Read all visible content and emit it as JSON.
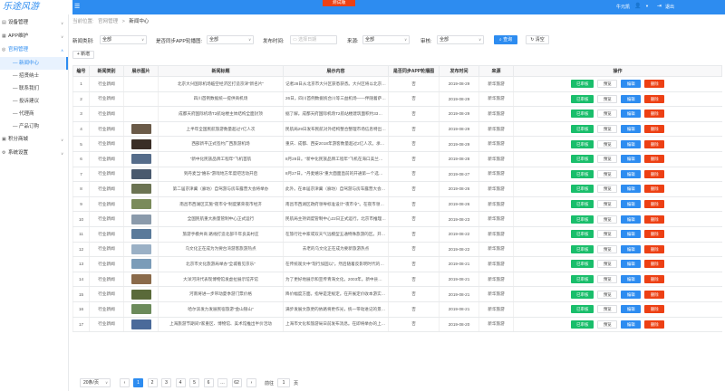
{
  "header": {
    "logo": "乐途风游",
    "env_tag": "测试版",
    "user": "牛元凯",
    "logout": "退出"
  },
  "sidebar": {
    "items": [
      {
        "label": "设备管理"
      },
      {
        "label": "APP维护"
      },
      {
        "label": "官网管理"
      }
    ],
    "subitems": [
      {
        "label": "— 新闻中心"
      },
      {
        "label": "— 招贤纳士"
      },
      {
        "label": "— 联系我们"
      },
      {
        "label": "— 投诉建议"
      },
      {
        "label": "— 代理商"
      },
      {
        "label": "— 产品订购"
      }
    ],
    "items_bottom": [
      {
        "label": "积分商城"
      },
      {
        "label": "系统设置"
      }
    ]
  },
  "breadcrumb": {
    "home_prefix": "当前位置:",
    "level1": "官网管理",
    "sep": ">",
    "level2": "新闻中心"
  },
  "filters": {
    "category_label": "新闻类别:",
    "category_value": "全部",
    "sync_label": "是否同步APP轮播图:",
    "sync_value": "全部",
    "time_label": "发布时间:",
    "time_placeholder": "选择日期",
    "source_label": "来源:",
    "source_value": "全部",
    "audit_label": "审核:",
    "audit_value": "全部",
    "query": "查询",
    "clear": "清空"
  },
  "toolbar": {
    "add": "+ 新增"
  },
  "table": {
    "headers": [
      "编号",
      "新闻类别",
      "展示图片",
      "新闻标题",
      "展示内容",
      "是否同步APP轮播图",
      "发布时间",
      "来源",
      "操作"
    ],
    "action_labels": {
      "audit": "已审核",
      "preview": "预览",
      "edit": "编辑",
      "delete": "删除"
    },
    "rows": [
      {
        "id": "1",
        "cat": "行业新闻",
        "title": "北京大兴国际机场临空经济区打造京津\"新名片\"",
        "content": "记者28日从北京市大兴区获悉获悉。大兴区将以北京大兴国际...",
        "sync": "否",
        "date": "2019-08-29",
        "src": "新华旅游",
        "thumb": ""
      },
      {
        "id": "2",
        "cat": "行业新闻",
        "title": "四川首例数据统一提供商机场",
        "content": "26日。四川首例数据统合川等三益机场——伴随着萨尔机场新...",
        "sync": "否",
        "date": "2019-08-29",
        "src": "新华旅游",
        "thumb": ""
      },
      {
        "id": "3",
        "cat": "行业新闻",
        "title": "成都天府国际机场T2航站楼主体结构全面封顶",
        "content": "据了解。成都天府国际机场T2航站楼建筑面积约33万平方米。...",
        "sync": "否",
        "date": "2019-08-29",
        "src": "新华旅游",
        "thumb": ""
      },
      {
        "id": "4",
        "cat": "行业新闻",
        "title": "上半年全国民航旅游数量超过7亿人次",
        "content": "民航局29日发布民航对外结构整合整理市场信息特出，今年...",
        "sync": "否",
        "date": "2019-08-29",
        "src": "新华旅游",
        "thumb": "#6a5a48"
      },
      {
        "id": "5",
        "cat": "行业新闻",
        "title": "西部新平正式签约广西旅游机场",
        "content": "重庆、成都、西安2018年游客数量超过2亿人次。承载能、车子挤...",
        "sync": "否",
        "date": "2019-08-29",
        "src": "新华旅游",
        "thumb": "#3a2e26"
      },
      {
        "id": "6",
        "cat": "行业新闻",
        "title": "\"新中化民族品牌工程年\"飞机首航",
        "content": "8月28日。\"新中化民族品牌工程年\"飞机在海口美兰机场首飞...",
        "sync": "否",
        "date": "2019-08-28",
        "src": "新华旅游",
        "thumb": "#556c8a"
      },
      {
        "id": "7",
        "cat": "行业新闻",
        "title": "到丹麦当\"嬉乐\"游戏地方年度吧活动开启",
        "content": "8月27日。\"丹麦嬉乐\"重大面面直前的开通第一个选定会...",
        "sync": "否",
        "date": "2019-08-27",
        "src": "新华旅游",
        "thumb": "#4a5a6e"
      },
      {
        "id": "8",
        "cat": "行业新闻",
        "title": "第二届京津冀（廊坊）自驾游与房车露营大会将举办",
        "content": "此外。在本届京津冀（廊坊）自驾游与房车露营大会分会场中...",
        "sync": "否",
        "date": "2019-08-26",
        "src": "新华旅游",
        "thumb": "#6b7352"
      },
      {
        "id": "9",
        "cat": "行业新闻",
        "title": "南昌市西湖区实施\"夜市令\"制度繁荣夜市经济",
        "content": "南昌市西湖区政府领导标准设计\"夜市令\"。在夜市领域发现问题...",
        "sync": "否",
        "date": "2019-08-26",
        "src": "新华旅游",
        "thumb": "#7a8b5a"
      },
      {
        "id": "10",
        "cat": "行业新闻",
        "title": "全国民航重大质量管制中心正式运行",
        "content": "民航局主持调度管制中心22日正式运行。北京市推理管制中心...",
        "sync": "否",
        "date": "2019-08-23",
        "src": "新华旅游",
        "thumb": "#8a9aab"
      },
      {
        "id": "11",
        "cat": "行业新闻",
        "title": "旅游手模共商 路线打造北部千年良美村庄",
        "content": "在旅行社中家或双天气远模型五通特殊旅游的区。开日在旅路...",
        "sync": "否",
        "date": "2019-08-22",
        "src": "新华旅游",
        "thumb": "#5a7a9a"
      },
      {
        "id": "12",
        "cat": "行业新闻",
        "title": "乌文化正在成为为要台湾游客旅游热点",
        "content": "去老的乌文化正在成为要新旅游热点",
        "sync": "否",
        "date": "2019-08-22",
        "src": "新华旅游",
        "thumb": "#9ab0c5"
      },
      {
        "id": "13",
        "cat": "行业新闻",
        "title": "北京市文化旅游局举办\"全城看见京乐\"",
        "content": "在传统观文中\"现行加固以\"。然后随着反影明时代的如果。企业...",
        "sync": "否",
        "date": "2019-08-21",
        "src": "新华旅游",
        "thumb": "#7b9cb8"
      },
      {
        "id": "14",
        "cat": "行业新闻",
        "title": "大洋河湾代表现博物馆发虚拉展示馆开馆",
        "content": "为了更好地展示和宣传青海文化。2003年。新中县在南代大量...",
        "sync": "否",
        "date": "2019-08-21",
        "src": "新华旅游",
        "thumb": "#8a6a4a"
      },
      {
        "id": "15",
        "cat": "行业新闻",
        "title": "河南将进一步带动夏季游门票价格",
        "content": "降价幅度方面。指导是定规定。在开展定价收本游实道成本...",
        "sync": "否",
        "date": "2019-08-21",
        "src": "新华旅游",
        "thumb": "#5a6a3a"
      },
      {
        "id": "16",
        "cat": "行业新闻",
        "title": "哈尔滨发力发展民宿旅游\"金山银山\"",
        "content": "满步发展文旅更的依路将更作光，统一带动进记的景点，...",
        "sync": "否",
        "date": "2019-08-21",
        "src": "新华旅游",
        "thumb": "#6b8a5a"
      },
      {
        "id": "17",
        "cat": "行业新闻",
        "title": "上海旅游节期间7家重区、博物馆、美术馆推出半价活动",
        "content": "上海市文化和旅游局日前发布消息。在即将举办的上海旅游节...",
        "sync": "否",
        "date": "2019-08-20",
        "src": "新华旅游",
        "thumb": "#4a6a9a"
      }
    ]
  },
  "pager": {
    "size": "20条/页",
    "prev": "‹",
    "pages": [
      "1",
      "2",
      "3",
      "4",
      "5",
      "6",
      "…",
      "62"
    ],
    "current": "1",
    "next": "›",
    "goto_label": "前往",
    "goto_value": "1",
    "goto_suffix": "页"
  }
}
